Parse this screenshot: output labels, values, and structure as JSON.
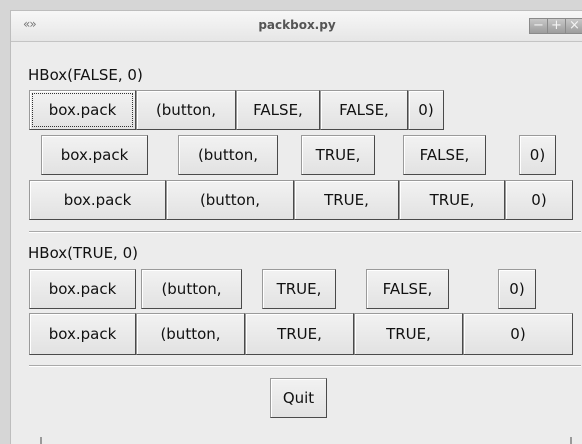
{
  "window": {
    "title": "packbox.py",
    "menu_glyph": "«»",
    "controls": {
      "minimize": "−",
      "maximize": "+",
      "close": "×"
    }
  },
  "section1": {
    "label": "HBox(FALSE, 0)",
    "rows": [
      [
        "box.pack",
        "(button,",
        "FALSE,",
        "FALSE,",
        "0)"
      ],
      [
        "box.pack",
        "(button,",
        "TRUE,",
        "FALSE,",
        "0)"
      ],
      [
        "box.pack",
        "(button,",
        "TRUE,",
        "TRUE,",
        "0)"
      ]
    ]
  },
  "section2": {
    "label": "HBox(TRUE, 0)",
    "rows": [
      [
        "box.pack",
        "(button,",
        "TRUE,",
        "FALSE,",
        "0)"
      ],
      [
        "box.pack",
        "(button,",
        "TRUE,",
        "TRUE,",
        "0)"
      ]
    ]
  },
  "quit_label": "Quit"
}
